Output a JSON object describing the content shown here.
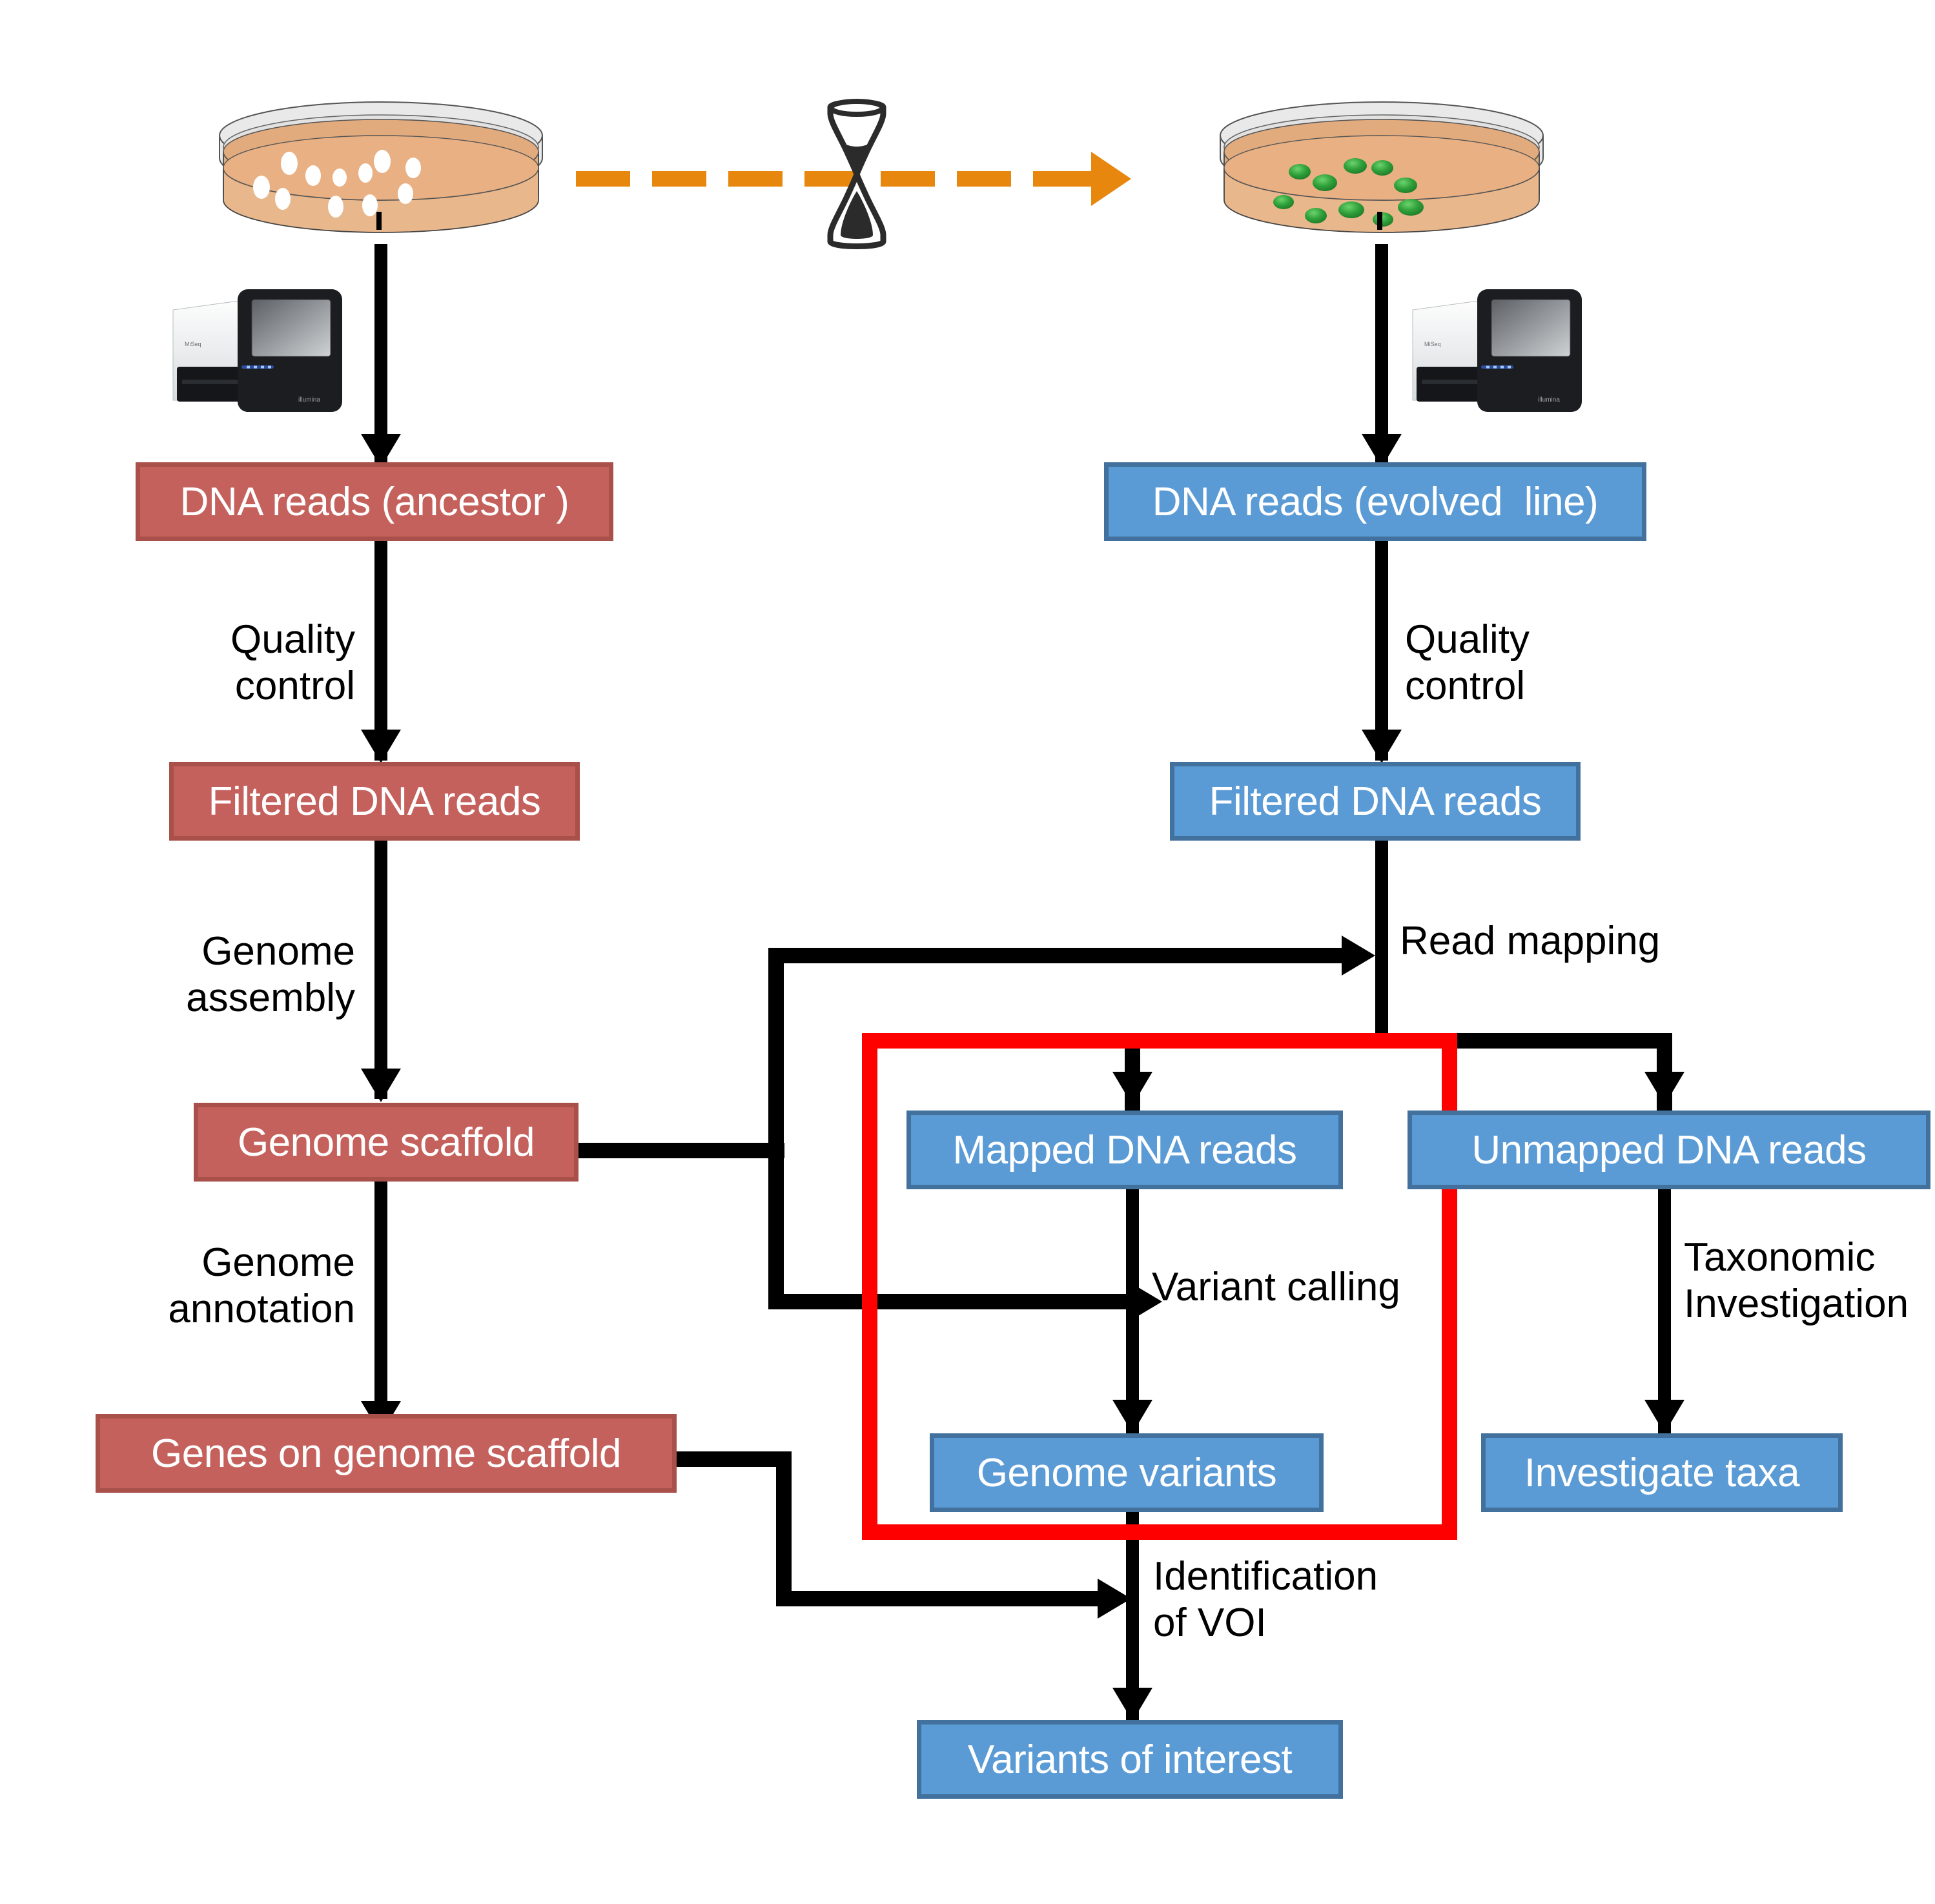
{
  "diagram": {
    "title": "Experimental evolution genome sequencing and variant analysis workflow",
    "colors": {
      "ancestor_box_fill": "#c5615c",
      "ancestor_box_border": "#a9504b",
      "evolved_box_fill": "#5b9bd5",
      "evolved_box_border": "#41719c",
      "highlight_rectangle": "#ff0000",
      "timeline_arrow": "#e8870d",
      "agar": "#e8b083",
      "ancestor_colony": "#ffffff",
      "evolved_colony": "#2fa03a",
      "connector": "#000000"
    }
  },
  "top_row": {
    "ancestor_plate": {
      "name": "petri-dish-ancestor",
      "colony_color": "#ffffff",
      "colony_count": 11
    },
    "evolved_plate": {
      "name": "petri-dish-evolved",
      "colony_color": "#2fa03a",
      "colony_count": 10
    },
    "timeline": {
      "icon": "hourglass-icon",
      "arrow": "dashed-arrow-right",
      "dash_count": 7
    },
    "sequencer_left": {
      "brand": "illumina",
      "model": "MiSeq"
    },
    "sequencer_right": {
      "brand": "illumina",
      "model": "MiSeq"
    }
  },
  "boxes": {
    "dna_reads_ancestor": "DNA reads (ancestor )",
    "dna_reads_evolved": "DNA reads (evolved  line)",
    "filtered_reads_ancestor": "Filtered DNA reads",
    "filtered_reads_evolved": "Filtered DNA reads",
    "genome_scaffold": "Genome scaffold",
    "genes_on_genome_scaffold": "Genes on genome scaffold",
    "mapped_dna_reads": "Mapped DNA reads",
    "unmapped_dna_reads": "Unmapped DNA reads",
    "genome_variants": "Genome variants",
    "investigate_taxa": "Investigate taxa",
    "variants_of_interest": "Variants of interest"
  },
  "edge_labels": {
    "quality_control_left": "Quality\ncontrol",
    "quality_control_right": "Quality\ncontrol",
    "genome_assembly": "Genome\nassembly",
    "genome_annotation": "Genome\nannotation",
    "read_mapping": "Read mapping",
    "variant_calling": "Variant calling",
    "taxonomic_investigation": "Taxonomic\nInvestigation",
    "identification_of_voi": "Identification\nof VOI"
  }
}
